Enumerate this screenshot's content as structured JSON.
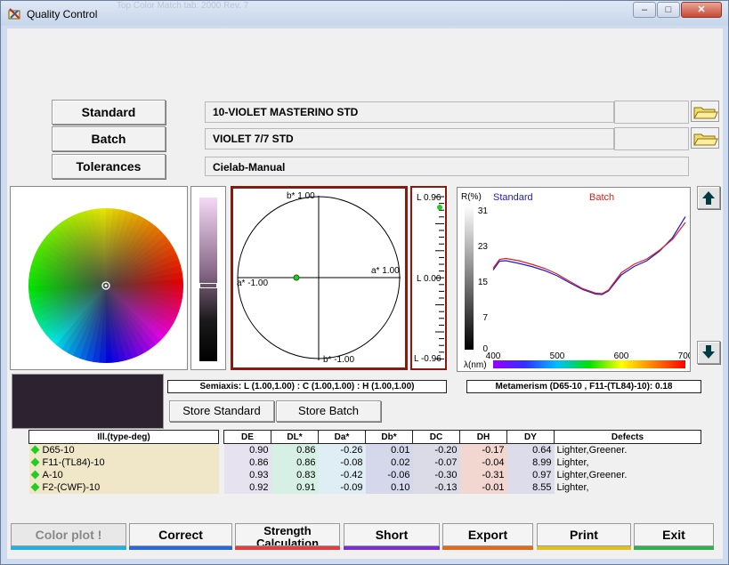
{
  "window": {
    "title": "Quality Control",
    "ghost_title": "Top Color Match tab: 2000 Rev. 7"
  },
  "buttons": {
    "standard": "Standard",
    "batch": "Batch",
    "tolerances": "Tolerances",
    "store_standard": "Store Standard",
    "store_batch": "Store Batch"
  },
  "fields": {
    "standard_name": "10-VIOLET MASTERINO  STD",
    "batch_name": "VIOLET 7/7  STD",
    "tolerance_name": "Cielab-Manual"
  },
  "plot": {
    "b_top": "b* 1.00",
    "b_bottom": "b* -1.00",
    "a_left": "a* -1.00",
    "a_right": "a* 1.00",
    "l_top": "L 0.96",
    "l_mid": "L 0.00",
    "l_bottom": "L -0.96"
  },
  "spectrum": {
    "r_label": "R(%)",
    "standard_label": "Standard",
    "batch_label": "Batch",
    "y_ticks": [
      "31",
      "23",
      "15",
      "7",
      "0"
    ],
    "x_ticks": [
      "400",
      "500",
      "600",
      "700"
    ],
    "x_label": "λ(nm)",
    "colors": {
      "standard": "#1a1ad8",
      "batch": "#e21c1c"
    }
  },
  "chart_data": {
    "type": "line",
    "xlabel": "λ(nm)",
    "ylabel": "R(%)",
    "xlim": [
      400,
      700
    ],
    "ylim": [
      0,
      31
    ],
    "series": [
      {
        "name": "Standard",
        "x": [
          400,
          410,
          420,
          440,
          460,
          480,
          500,
          520,
          540,
          560,
          570,
          580,
          600,
          620,
          640,
          660,
          680,
          700
        ],
        "values": [
          17.5,
          19.5,
          19.6,
          19.0,
          18.3,
          17.4,
          16.2,
          14.6,
          13.1,
          12.1,
          12.0,
          12.8,
          16.4,
          18.3,
          19.6,
          21.8,
          24.8,
          29.5
        ]
      },
      {
        "name": "Batch",
        "x": [
          400,
          410,
          420,
          440,
          460,
          480,
          500,
          520,
          540,
          560,
          570,
          580,
          600,
          620,
          640,
          660,
          680,
          700
        ],
        "values": [
          17.9,
          19.9,
          20.1,
          19.6,
          18.8,
          17.9,
          16.6,
          14.9,
          13.3,
          12.3,
          12.2,
          13.0,
          16.9,
          18.8,
          20.0,
          22.0,
          24.4,
          28.2
        ]
      }
    ]
  },
  "summary": {
    "semiaxis": "Semiaxis: L (1.00,1.00)  : C (1.00,1.00)  : H (1.00,1.00)",
    "metamerism": "Metamerism  (D65-10 , F11-(TL84)-10):  0.18"
  },
  "table": {
    "headers": [
      "Ill.(type-deg)",
      "DE",
      "DL*",
      "Da*",
      "Db*",
      "DC",
      "DH",
      "DY",
      "Defects"
    ],
    "rows": [
      [
        "D65-10",
        "0.90",
        "0.86",
        "-0.26",
        "0.01",
        "-0.20",
        "-0.17",
        "0.64",
        "Lighter,Greener."
      ],
      [
        "F11-(TL84)-10",
        "0.86",
        "0.86",
        "-0.08",
        "0.02",
        "-0.07",
        "-0.04",
        "8.99",
        "Lighter,"
      ],
      [
        "A-10",
        "0.93",
        "0.83",
        "-0.42",
        "-0.06",
        "-0.30",
        "-0.31",
        "0.97",
        "Lighter,Greener."
      ],
      [
        "F2-(CWF)-10",
        "0.92",
        "0.91",
        "-0.09",
        "0.10",
        "-0.13",
        "-0.01",
        "8.55",
        "Lighter,"
      ]
    ]
  },
  "bottom": {
    "color_plot": "Color plot !",
    "correct": "Correct",
    "strength": "Strength Calculation",
    "short": "Short",
    "export": "Export",
    "print": "Print",
    "exit": "Exit"
  },
  "colors": {
    "sample_swatch": "#2c2230",
    "row_green_marker": "#22cc22"
  }
}
